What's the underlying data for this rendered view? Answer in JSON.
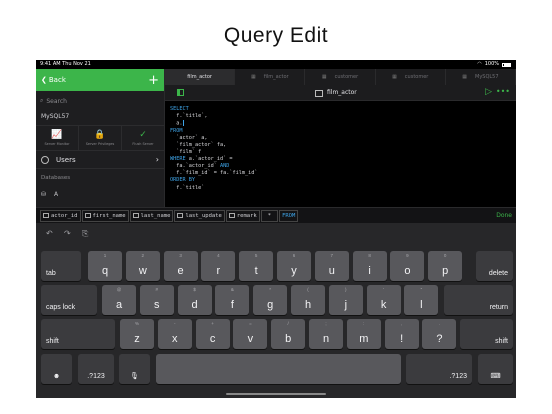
{
  "headline": "Query Edit",
  "status": {
    "time": "9:41 AM  Thu Nov 21",
    "battery": "100%"
  },
  "sidebar": {
    "back_label": "Back",
    "add_label": "+",
    "search_placeholder": "Search",
    "connection": "MySQL57",
    "tools": [
      {
        "icon": "chart-icon",
        "glyph": "📈",
        "label": "Server Monitor"
      },
      {
        "icon": "lock-icon",
        "glyph": "🔒",
        "label": "Server Privileges"
      },
      {
        "icon": "check-icon",
        "glyph": "✓",
        "label": "Flush Server"
      }
    ],
    "users_label": "Users",
    "databases_label": "Databases",
    "db_item": "A"
  },
  "tabs": [
    {
      "label": "film_actor",
      "active": true
    },
    {
      "label": "film_actor",
      "active": false
    },
    {
      "label": "customer",
      "active": false
    },
    {
      "label": "customer",
      "active": false
    },
    {
      "label": "MySQL57",
      "active": false
    }
  ],
  "editor": {
    "title": "film_actor",
    "code": [
      {
        "kw": "SELECT",
        "tx": ""
      },
      {
        "kw": "",
        "tx": "  f.`title`,"
      },
      {
        "kw": "",
        "tx": "  a.",
        "caret": true
      },
      {
        "kw": "FROM",
        "tx": ""
      },
      {
        "kw": "",
        "tx": "  `actor` a,"
      },
      {
        "kw": "",
        "tx": "  `film_actor` fa,"
      },
      {
        "kw": "",
        "tx": "  `film` f"
      },
      {
        "kw": "WHERE",
        "tx": " a.`actor_id` ="
      },
      {
        "kw": "",
        "tx": "  fa.`actor_id` ",
        "kw2": "AND"
      },
      {
        "kw": "",
        "tx": "  f.`film_id` = fa.`film_id`"
      },
      {
        "kw": "ORDER BY",
        "tx": ""
      },
      {
        "kw": "",
        "tx": "  f.`title`"
      }
    ]
  },
  "suggestions": {
    "items": [
      {
        "label": "actor_id",
        "kind": "column"
      },
      {
        "label": "first_name",
        "kind": "column"
      },
      {
        "label": "last_name",
        "kind": "column"
      },
      {
        "label": "last_update",
        "kind": "column"
      },
      {
        "label": "remark",
        "kind": "column"
      },
      {
        "label": "*",
        "kind": "op"
      },
      {
        "label": "FROM",
        "kind": "keyword"
      }
    ],
    "done_label": "Done"
  },
  "keyboard": {
    "undo": "↶",
    "redo": "↷",
    "paste": "⎘",
    "row1": [
      [
        "q",
        "1"
      ],
      [
        "w",
        "2"
      ],
      [
        "e",
        "3"
      ],
      [
        "r",
        "4"
      ],
      [
        "t",
        "5"
      ],
      [
        "y",
        "6"
      ],
      [
        "u",
        "7"
      ],
      [
        "i",
        "8"
      ],
      [
        "o",
        "9"
      ],
      [
        "p",
        "0"
      ]
    ],
    "row2": [
      [
        "a",
        "@"
      ],
      [
        "s",
        "#"
      ],
      [
        "d",
        "$"
      ],
      [
        "f",
        "&"
      ],
      [
        "g",
        "*"
      ],
      [
        "h",
        "("
      ],
      [
        "j",
        ")"
      ],
      [
        "k",
        "'"
      ],
      [
        "l",
        "\""
      ]
    ],
    "row3": [
      [
        "z",
        "%"
      ],
      [
        "x",
        "-"
      ],
      [
        "c",
        "+"
      ],
      [
        "v",
        "="
      ],
      [
        "b",
        "/"
      ],
      [
        "n",
        ";"
      ],
      [
        "m",
        ":"
      ],
      [
        "!",
        ","
      ],
      [
        "?",
        "."
      ]
    ],
    "tab": "tab",
    "delete": "delete",
    "caps": "caps lock",
    "return": "return",
    "shift": "shift",
    "numbers": ".?123",
    "emoji": "☻",
    "mic": "🎙",
    "hide": "⌨"
  }
}
